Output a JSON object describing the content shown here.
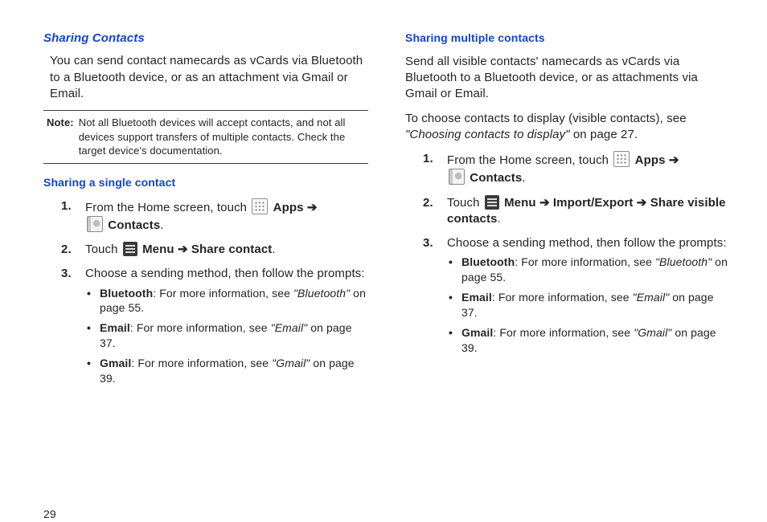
{
  "page_number": "29",
  "left": {
    "heading": "Sharing Contacts",
    "intro": "You can send contact namecards as vCards via Bluetooth to a Bluetooth device, or as an attachment via Gmail or Email.",
    "note_label": "Note:",
    "note_body": "Not all Bluetooth devices will accept contacts, and not all devices support transfers of multiple contacts. Check the target device's documentation.",
    "sub1": "Sharing a single contact",
    "s1_a": "From the Home screen, touch ",
    "s1_apps": "Apps",
    "s1_arrow": "➔",
    "s1_contacts": "Contacts",
    "s1_dot": ".",
    "s2_a": "Touch ",
    "s2_menu": "Menu",
    "s2_arrow": " ➔ ",
    "s2_b": "Share contact",
    "s2_dot": ".",
    "s3": "Choose a sending method, then follow the prompts:",
    "b1_label": "Bluetooth",
    "b1_text": ": For more information, see ",
    "b1_ref": "\"Bluetooth\"",
    "b1_pg": " on page 55.",
    "b2_label": "Email",
    "b2_text": ": For more information, see ",
    "b2_ref": "\"Email\"",
    "b2_pg": " on page 37.",
    "b3_label": "Gmail",
    "b3_text": ": For more information, see ",
    "b3_ref": "\"Gmail\"",
    "b3_pg": " on page 39."
  },
  "right": {
    "sub1": "Sharing multiple contacts",
    "intro": "Send all visible contacts' namecards as vCards via Bluetooth to a Bluetooth device, or as attachments via Gmail or Email.",
    "para2a": "To choose contacts to display (visible contacts), see ",
    "para2ref": "\"Choosing contacts to display\"",
    "para2b": " on page 27.",
    "s1_a": "From the Home screen, touch ",
    "s1_apps": "Apps",
    "s1_arrow": "➔",
    "s1_contacts": "Contacts",
    "s1_dot": ".",
    "s2_a": "Touch ",
    "s2_menu": "Menu",
    "s2_arrow1": " ➔ ",
    "s2_b": "Import/Export",
    "s2_arrow2": " ➔ ",
    "s2_c": "Share visible contacts",
    "s2_dot": ".",
    "s3": "Choose a sending method, then follow the prompts:",
    "b1_label": "Bluetooth",
    "b1_text": ": For more information, see ",
    "b1_ref": "\"Bluetooth\"",
    "b1_pg": " on page 55.",
    "b2_label": "Email",
    "b2_text": ": For more information, see ",
    "b2_ref": "\"Email\"",
    "b2_pg": " on page 37.",
    "b3_label": "Gmail",
    "b3_text": ": For more information, see ",
    "b3_ref": "\"Gmail\"",
    "b3_pg": " on page 39."
  }
}
